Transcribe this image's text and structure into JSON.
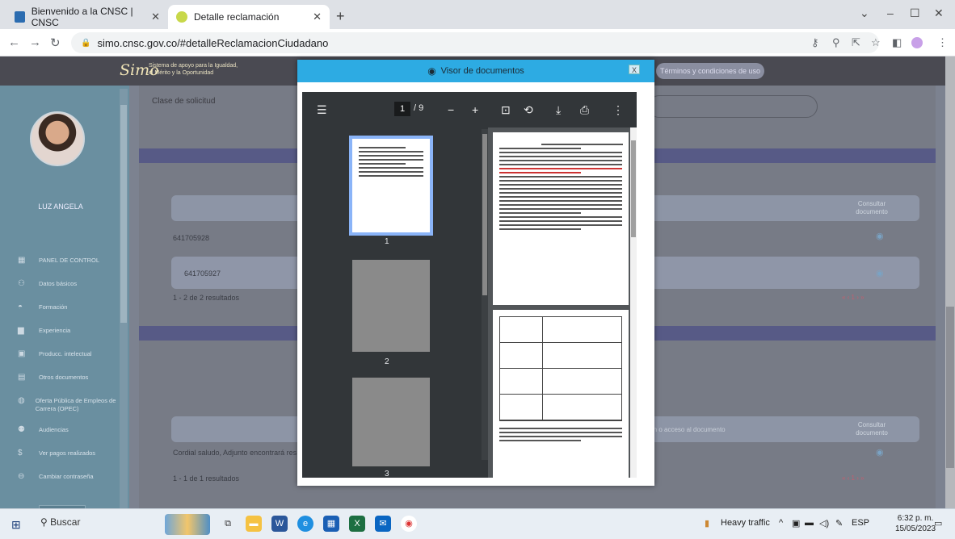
{
  "browser": {
    "tabs": [
      {
        "title": "Bienvenido a la CNSC | CNSC",
        "active": false
      },
      {
        "title": "Detalle reclamación",
        "active": true
      }
    ],
    "new_tab_label": "+",
    "address": "simo.cnsc.gov.co/#detalleReclamacionCiudadano"
  },
  "site": {
    "logo": "Simo",
    "logo_subtitle_1": "Sistema de apoyo para la Igualdad,",
    "logo_subtitle_2": "el Mérito y la Oportunidad",
    "terms_button": "Términos y condiciones de uso",
    "username": "LUZ ANGELA",
    "menu": [
      {
        "label": "PANEL DE CONTROL",
        "icon": "dashboard-icon"
      },
      {
        "label": "Datos básicos",
        "icon": "users-icon"
      },
      {
        "label": "Formación",
        "icon": "graduation-icon"
      },
      {
        "label": "Experiencia",
        "icon": "briefcase-icon"
      },
      {
        "label": "Producc. intelectual",
        "icon": "book-icon"
      },
      {
        "label": "Otros documentos",
        "icon": "document-icon"
      },
      {
        "label": "Oferta Pública de Empleos de Carrera (OPEC)",
        "icon": "globe-icon"
      },
      {
        "label": "Audiencias",
        "icon": "audience-icon"
      },
      {
        "label": "Ver pagos realizados",
        "icon": "dollar-icon"
      },
      {
        "label": "Cambiar contraseña",
        "icon": "lock-icon"
      }
    ]
  },
  "main": {
    "request_class_label": "Clase de solicitud",
    "consult_header_1": "Consultar documento",
    "row1_id": "641705928",
    "row2_id": "641705927",
    "results_1": "1 - 2 de 2 resultados",
    "pager": "« ‹ 1 › »",
    "desc_header": "pción o acceso al documento",
    "consult_header_2": "Consultar documento",
    "message": "Cordial saludo, Adjunto encontrará res",
    "results_2": "1 - 1 de 1 resultados"
  },
  "modal": {
    "title": "Visor de documentos",
    "close_label": "X",
    "current_page": "1",
    "total_pages": "/ 9",
    "thumb_labels": [
      "1",
      "2",
      "3"
    ]
  },
  "taskbar": {
    "search_label": "Buscar",
    "weather": "Heavy traffic",
    "lang": "ESP",
    "time": "6:32 p. m.",
    "date": "15/05/2023"
  }
}
